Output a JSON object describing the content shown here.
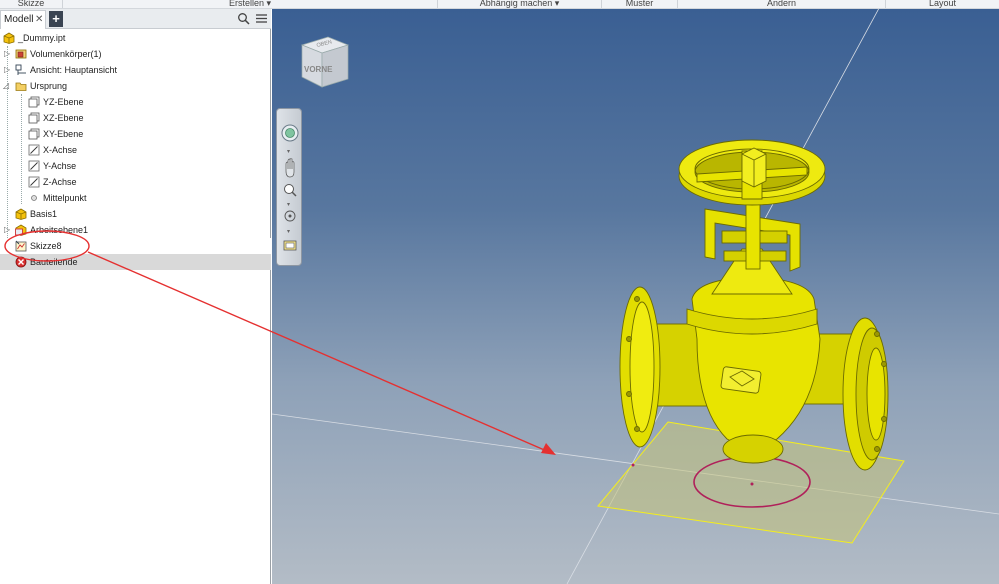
{
  "ribbon": {
    "groups": [
      {
        "label": "Skizze"
      },
      {
        "label": "Erstellen ▾"
      },
      {
        "label": "Abhängig machen ▾"
      },
      {
        "label": "Muster"
      },
      {
        "label": "Ändern"
      },
      {
        "label": "Layout"
      }
    ]
  },
  "browser": {
    "tab_label": "Modell",
    "close_glyph": "✕",
    "add_glyph": "+",
    "tree": [
      {
        "label": "_Dummy.ipt",
        "icon": "part-icon"
      },
      {
        "label": "Volumenkörper(1)",
        "icon": "solid-bodies-icon"
      },
      {
        "label": "Ansicht: Hauptansicht",
        "icon": "view-rep-icon"
      },
      {
        "label": "Ursprung",
        "icon": "origin-folder-icon"
      },
      {
        "label": "YZ-Ebene",
        "icon": "work-plane-icon"
      },
      {
        "label": "XZ-Ebene",
        "icon": "work-plane-icon"
      },
      {
        "label": "XY-Ebene",
        "icon": "work-plane-icon"
      },
      {
        "label": "X-Achse",
        "icon": "work-axis-icon"
      },
      {
        "label": "Y-Achse",
        "icon": "work-axis-icon"
      },
      {
        "label": "Z-Achse",
        "icon": "work-axis-icon"
      },
      {
        "label": "Mittelpunkt",
        "icon": "work-point-icon"
      },
      {
        "label": "Basis1",
        "icon": "base-feature-icon"
      },
      {
        "label": "Arbeitsebene1",
        "icon": "work-plane-feature-icon"
      },
      {
        "label": "Skizze8",
        "icon": "sketch-icon"
      },
      {
        "label": "Bauteilende",
        "icon": "end-of-part-icon"
      }
    ]
  },
  "viewcube": {
    "front_label": "VORNE",
    "top_label": "OBEN"
  },
  "colors": {
    "part_yellow": "#e8e400",
    "part_edge": "#6b6a00",
    "annotation_red": "#e53030",
    "sketch_circle": "#b0205a"
  }
}
